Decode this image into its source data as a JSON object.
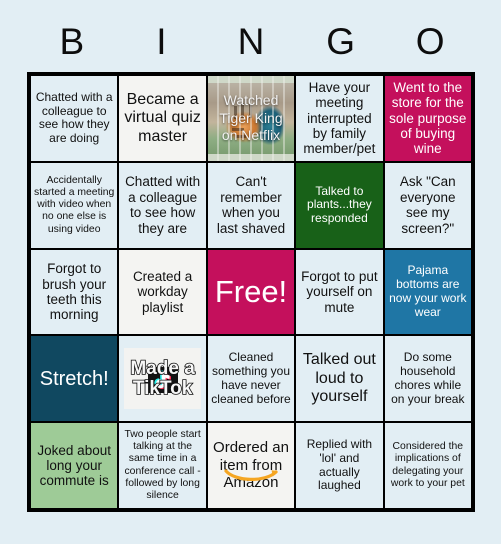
{
  "meta": {
    "background_color": "#e2eef4",
    "grid_border_color": "#000000"
  },
  "header": {
    "letters": [
      "B",
      "I",
      "N",
      "G",
      "O"
    ]
  },
  "palette": {
    "pale_blue": "#e2eef4",
    "off_white": "#f4f4f2",
    "magenta": "#c4105c",
    "dark_green": "#186118",
    "steel_blue": "#1f76a5",
    "navy_teal": "#104860",
    "light_green": "#9ecb97",
    "amazon_orange": "#f5a623",
    "tiktok_cyan": "#25f4ee",
    "tiktok_pink": "#fe2c55"
  },
  "grid": {
    "rows": 5,
    "cols": 5,
    "cells": [
      {
        "text": "Chatted with a colleague to see how they are doing",
        "bg": "pale",
        "fg": "dark",
        "size": "sm",
        "kind": "text"
      },
      {
        "text": "Became a virtual quiz master",
        "bg": "white",
        "fg": "dark",
        "size": "lg",
        "kind": "text"
      },
      {
        "text": "Watched Tiger King on Netflix",
        "bg": "image",
        "fg": "white",
        "size": "md",
        "kind": "image-tiger"
      },
      {
        "text": "Have your meeting interrupted by family member/pet",
        "bg": "pale",
        "fg": "dark",
        "size": "md",
        "kind": "text"
      },
      {
        "text": "Went to the store for the sole purpose of buying wine",
        "bg": "magenta",
        "fg": "white",
        "size": "md",
        "kind": "text"
      },
      {
        "text": "Accidentally started a meeting with video when no one else is using video",
        "bg": "pale",
        "fg": "dark",
        "size": "xs",
        "kind": "text"
      },
      {
        "text": "Chatted with a colleague to see how they are",
        "bg": "pale",
        "fg": "dark",
        "size": "md",
        "kind": "text"
      },
      {
        "text": "Can't remember when you last shaved",
        "bg": "pale",
        "fg": "dark",
        "size": "md",
        "kind": "text"
      },
      {
        "text": "Talked to plants...they responded",
        "bg": "dgreen",
        "fg": "white",
        "size": "sm",
        "kind": "text"
      },
      {
        "text": "Ask \"Can everyone see my screen?\"",
        "bg": "pale",
        "fg": "dark",
        "size": "md",
        "kind": "text"
      },
      {
        "text": "Forgot to brush your teeth this morning",
        "bg": "pale",
        "fg": "dark",
        "size": "md",
        "kind": "text"
      },
      {
        "text": "Created a workday playlist",
        "bg": "white",
        "fg": "dark",
        "size": "md",
        "kind": "text"
      },
      {
        "text": "Free!",
        "bg": "magenta",
        "fg": "white",
        "size": "free",
        "kind": "free"
      },
      {
        "text": "Forgot to put yourself on mute",
        "bg": "pale",
        "fg": "dark",
        "size": "md",
        "kind": "text"
      },
      {
        "text": "Pajama bottoms are now your work wear",
        "bg": "blue",
        "fg": "white",
        "size": "sm",
        "kind": "text"
      },
      {
        "text": "Stretch!",
        "bg": "navy",
        "fg": "white",
        "size": "stretch",
        "kind": "text"
      },
      {
        "text": "Made a TikTok",
        "bg": "pale",
        "fg": "dark",
        "size": "md",
        "kind": "tiktok"
      },
      {
        "text": "Cleaned something you have never cleaned before",
        "bg": "pale",
        "fg": "dark",
        "size": "sm",
        "kind": "text"
      },
      {
        "text": "Talked out loud to yourself",
        "bg": "pale",
        "fg": "dark",
        "size": "lg",
        "kind": "text"
      },
      {
        "text": "Do some household chores while on your break",
        "bg": "pale",
        "fg": "dark",
        "size": "sm",
        "kind": "text"
      },
      {
        "text": "Joked about long your commute is",
        "bg": "lgreen",
        "fg": "dark",
        "size": "md",
        "kind": "text"
      },
      {
        "text": "Two people start talking at the same time in a conference call - followed by long silence",
        "bg": "pale",
        "fg": "dark",
        "size": "xs",
        "kind": "text"
      },
      {
        "text": "Ordered an item from Amazon",
        "bg": "white",
        "fg": "dark",
        "size": "md",
        "kind": "amazon"
      },
      {
        "text": "Replied with 'lol' and actually laughed",
        "bg": "pale",
        "fg": "dark",
        "size": "sm",
        "kind": "text"
      },
      {
        "text": "Considered the implications of delegating your work to your pet",
        "bg": "pale",
        "fg": "dark",
        "size": "xs",
        "kind": "text"
      }
    ]
  }
}
